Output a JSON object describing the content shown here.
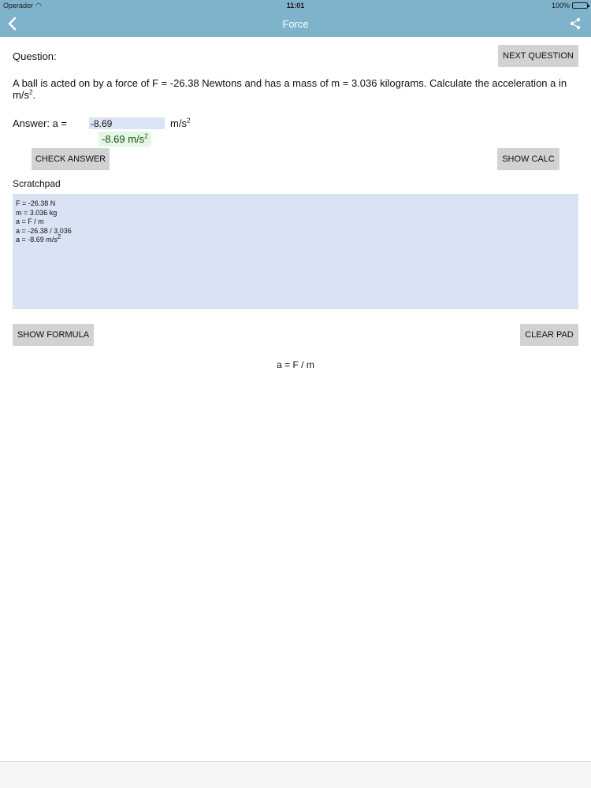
{
  "status_bar": {
    "carrier": "Operador",
    "time": "11:01",
    "battery": "100%",
    "battery_level": 1.0,
    "icons": [
      "wifi-icon",
      "battery-icon"
    ]
  },
  "nav": {
    "title": "Force",
    "back_icon": "chevron-left-icon",
    "share_icon": "share-icon"
  },
  "question": {
    "label": "Question:",
    "text_main": "A ball is acted on by a force of F = -26.38 Newtons  and  has a mass of m = 3.036 kilograms. Calculate the  acceleration a in m/s",
    "text_sup": "2",
    "text_end": ".",
    "next_button": "NEXT QUESTION"
  },
  "answer": {
    "label": "Answer:  a =",
    "value": "-8.69",
    "unit": "m/s",
    "unit_sup": "2",
    "correct_text": "-8.69 m/s",
    "correct_sup": "2"
  },
  "buttons": {
    "check_answer": "CHECK ANSWER",
    "show_calc": "SHOW CALC",
    "show_formula": "SHOW FORMULA",
    "clear_pad": "CLEAR PAD"
  },
  "scratchpad": {
    "label": "Scratchpad",
    "lines": [
      "F = -26.38 N",
      "m =  3.036 kg",
      "a = F / m",
      "a =  -26.38  /  3.036",
      "a =  -8.69 m/s"
    ],
    "last_line_sup": "2"
  },
  "formula": {
    "text": "a = F / m"
  },
  "colors": {
    "accent": "#7fb3cc",
    "button": "#d2d2d2",
    "scratchpad_bg": "#d9e3f4",
    "input_bg": "#dbe4f4",
    "correct_bg": "#e4f6e4"
  }
}
